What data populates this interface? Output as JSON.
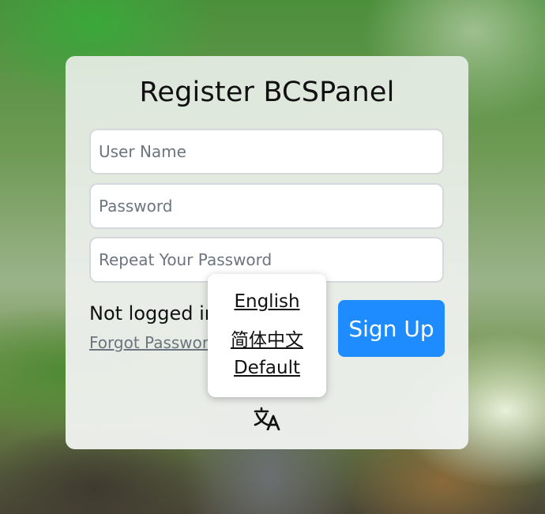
{
  "card": {
    "title": "Register BCSPanel"
  },
  "form": {
    "username_placeholder": "User Name",
    "password_placeholder": "Password",
    "repeat_password_placeholder": "Repeat Your Password"
  },
  "status_text": "Not logged in",
  "forgot_password_text": "Forgot Password",
  "signup_label": "Sign Up",
  "language_menu": {
    "options": [
      "English",
      "简体中文",
      "Default"
    ],
    "icon": "translate-icon"
  },
  "colors": {
    "primary_button": "#1e8bff",
    "link_muted": "#6c757d"
  }
}
